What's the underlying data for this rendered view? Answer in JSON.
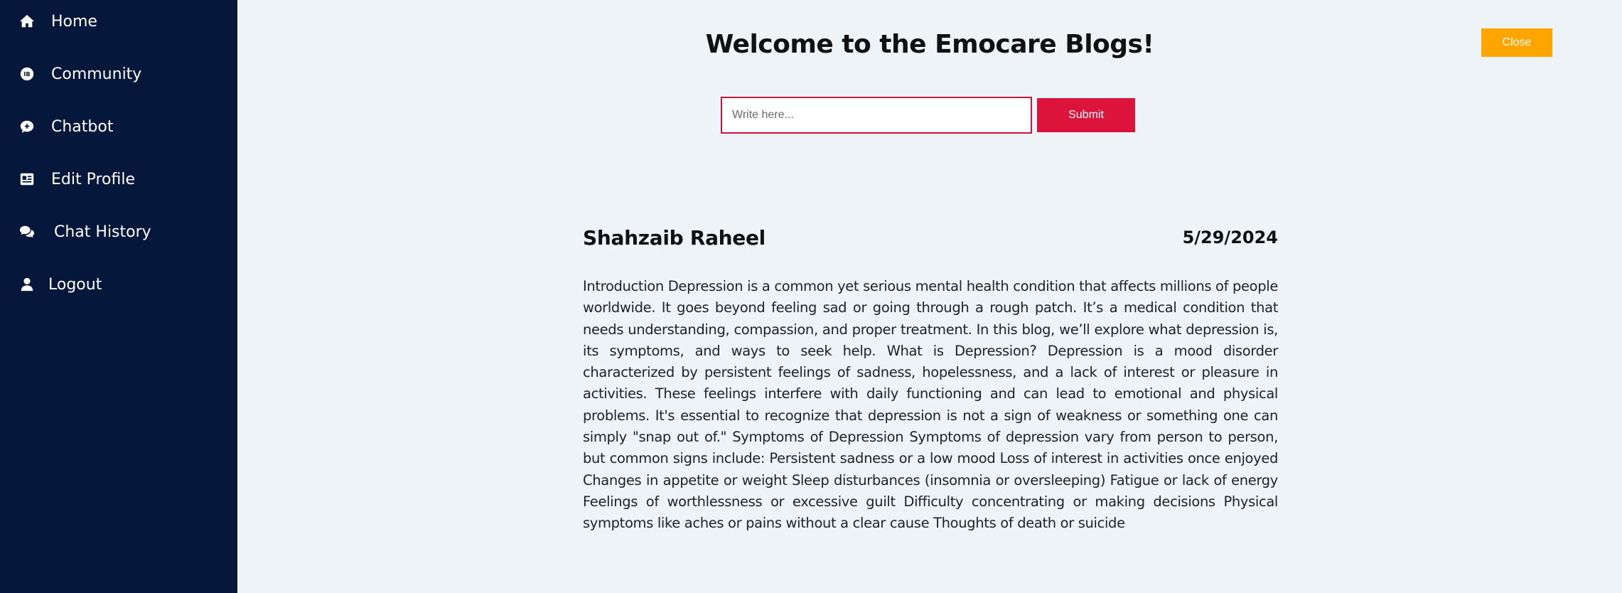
{
  "sidebar": {
    "items": [
      {
        "label": "Home",
        "icon": "home-icon"
      },
      {
        "label": "Community",
        "icon": "community-icon"
      },
      {
        "label": "Chatbot",
        "icon": "chatbot-icon"
      },
      {
        "label": "Edit Profile",
        "icon": "edit-profile-icon"
      },
      {
        "label": "Chat History",
        "icon": "chat-history-icon"
      },
      {
        "label": "Logout",
        "icon": "user-icon"
      }
    ]
  },
  "header": {
    "title": "Welcome to the Emocare Blogs!",
    "close_label": "Close"
  },
  "composer": {
    "placeholder": "Write here...",
    "value": "",
    "submit_label": "Submit"
  },
  "posts": [
    {
      "author": "Shahzaib Raheel",
      "date": "5/29/2024",
      "body": "Introduction Depression is a common yet serious mental health condition that affects millions of people worldwide. It goes beyond feeling sad or going through a rough patch. It’s a medical condition that needs understanding, compassion, and proper treatment. In this blog, we’ll explore what depression is, its symptoms, and ways to seek help. What is Depression? Depression is a mood disorder characterized by persistent feelings of sadness, hopelessness, and a lack of interest or pleasure in activities. These feelings interfere with daily functioning and can lead to emotional and physical problems. It's essential to recognize that depression is not a sign of weakness or something one can simply \"snap out of.\" Symptoms of Depression Symptoms of depression vary from person to person, but common signs include: Persistent sadness or a low mood Loss of interest in activities once enjoyed Changes in appetite or weight Sleep disturbances (insomnia or oversleeping) Fatigue or lack of energy Feelings of worthlessness or excessive guilt Difficulty concentrating or making decisions Physical symptoms like aches or pains without a clear cause Thoughts of death or suicide"
    }
  ],
  "colors": {
    "sidebar_bg": "#06173c",
    "page_bg": "#eef3f7",
    "close_button": "#ffa500",
    "submit_button": "#dc143c",
    "input_border": "#c4183c"
  }
}
